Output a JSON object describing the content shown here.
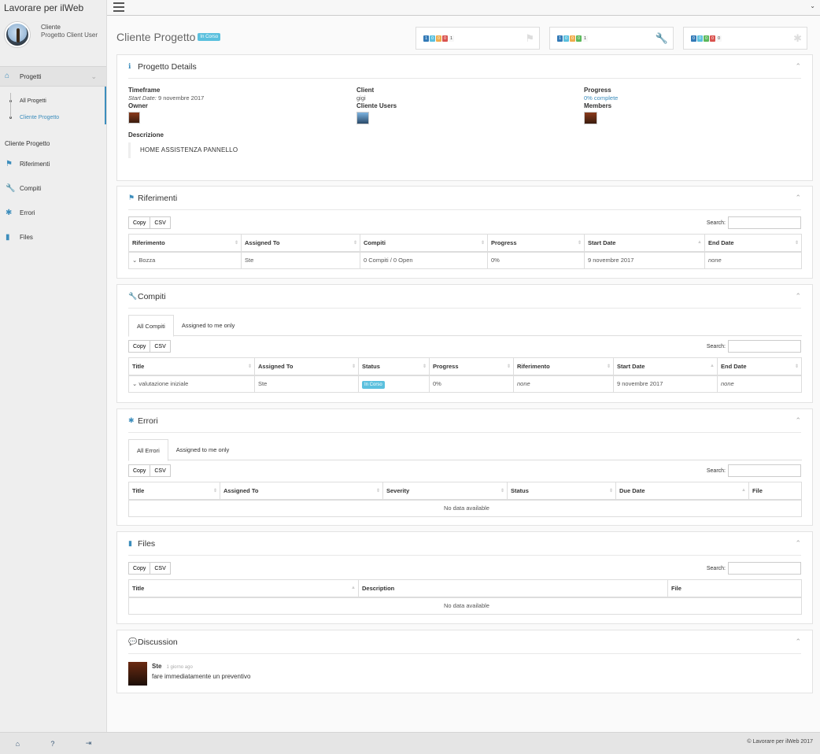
{
  "app": {
    "brand": "Lavorare per ilWeb"
  },
  "profile": {
    "name": "Cliente",
    "role": "Progetto Client User"
  },
  "sidebar": {
    "main_item": "Progetti",
    "sub_items": [
      {
        "label": "All Progetti"
      },
      {
        "label": "Cliente Progetto"
      }
    ],
    "section_title": "Cliente Progetto",
    "items": [
      {
        "label": "Riferimenti"
      },
      {
        "label": "Compiti"
      },
      {
        "label": "Errori"
      },
      {
        "label": "Files"
      }
    ]
  },
  "page": {
    "title": "Cliente Progetto",
    "status": "In Corso"
  },
  "stats": [
    {
      "values": [
        "1",
        "0",
        "0",
        "0",
        "1"
      ]
    },
    {
      "values": [
        "1",
        "0",
        "0",
        "0",
        "1"
      ]
    },
    {
      "values": [
        "0",
        "0",
        "0",
        "0",
        "0"
      ]
    }
  ],
  "details": {
    "title": "Progetto Details",
    "timeframe_label": "Timeframe",
    "start_date_label": "Start Date:",
    "start_date": "9 novembre 2017",
    "client_label": "Client",
    "client": "gigi",
    "progress_label": "Progress",
    "progress": "0% complete",
    "owner_label": "Owner",
    "client_users_label": "Cliente Users",
    "members_label": "Members",
    "description_label": "Descrizione",
    "description": "HOME ASSISTENZA PANNELLO"
  },
  "buttons": {
    "copy": "Copy",
    "csv": "CSV",
    "search": "Search:"
  },
  "riferimenti": {
    "title": "Riferimenti",
    "headers": [
      "Riferimento",
      "Assigned To",
      "Compiti",
      "Progress",
      "Start Date",
      "End Date"
    ],
    "row": [
      "Bozza",
      "Ste",
      "0 Compiti / 0 Open",
      "0%",
      "9 novembre 2017",
      "none"
    ]
  },
  "compiti": {
    "title": "Compiti",
    "tabs": [
      "All Compiti",
      "Assigned to me only"
    ],
    "headers": [
      "Title",
      "Assigned To",
      "Status",
      "Progress",
      "Riferimento",
      "Start Date",
      "End Date"
    ],
    "row": [
      "valutazione iniziale",
      "Ste",
      "In Corso",
      "0%",
      "none",
      "9 novembre 2017",
      "none"
    ]
  },
  "errori": {
    "title": "Errori",
    "tabs": [
      "All Errori",
      "Assigned to me only"
    ],
    "headers": [
      "Title",
      "Assigned To",
      "Severity",
      "Status",
      "Due Date",
      "File"
    ],
    "empty": "No data available"
  },
  "files": {
    "title": "Files",
    "headers": [
      "Title",
      "Description",
      "File"
    ],
    "empty": "No data available"
  },
  "discussion": {
    "title": "Discussion",
    "author": "Ste",
    "time": "1 giorno ago",
    "message": "fare immediatamente un preventivo"
  },
  "footer": {
    "copyright": "© Lavorare per ilWeb 2017"
  },
  "colors": {
    "accent": "#3c8dbc",
    "info": "#5bc0de"
  }
}
